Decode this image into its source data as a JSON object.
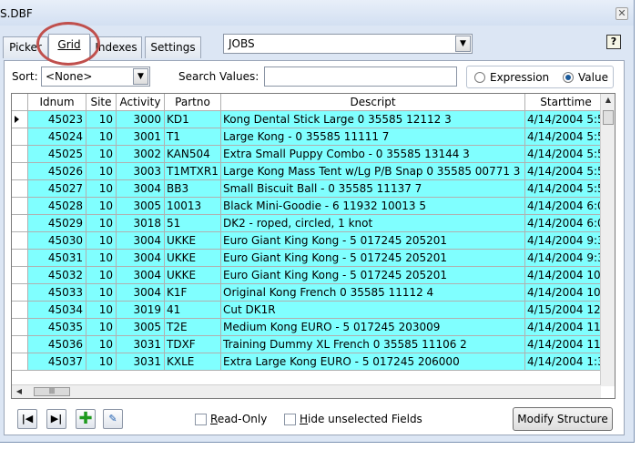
{
  "window": {
    "title": "S.DBF"
  },
  "tabs": [
    {
      "label": "Picker"
    },
    {
      "label": "Grid"
    },
    {
      "label": "Indexes"
    },
    {
      "label": "Settings"
    }
  ],
  "active_tab": "Grid",
  "table_select": {
    "value": "JOBS"
  },
  "help_icon": "help-icon",
  "sort": {
    "label": "Sort:",
    "value": "<None>"
  },
  "search": {
    "label": "Search Values:",
    "value": ""
  },
  "search_mode": {
    "options": [
      "Expression",
      "Value"
    ],
    "selected": "Value"
  },
  "grid": {
    "columns": [
      "Idnum",
      "Site",
      "Activity",
      "Partno",
      "Descript",
      "Starttime"
    ],
    "rows": [
      [
        "45023",
        "10",
        "3000",
        "KD1",
        "Kong Dental Stick Large 0 35585 12112 3",
        "4/14/2004 5:5"
      ],
      [
        "45024",
        "10",
        "3001",
        "T1",
        "Large Kong - 0 35585 11111 7",
        "4/14/2004 5:5"
      ],
      [
        "45025",
        "10",
        "3002",
        "KAN504",
        "Extra Small Puppy Combo - 0 35585 13144 3",
        "4/14/2004 5:5"
      ],
      [
        "45026",
        "10",
        "3003",
        "T1MTXR1",
        "Large Kong Mass Tent w/Lg P/B Snap 0 35585 00771 3",
        "4/14/2004 5:5"
      ],
      [
        "45027",
        "10",
        "3004",
        "BB3",
        "Small Biscuit Ball - 0 35585 11137 7",
        "4/14/2004 5:5"
      ],
      [
        "45028",
        "10",
        "3005",
        "10013",
        "Black Mini-Goodie - 6 11932 10013 5",
        "4/14/2004 6:0"
      ],
      [
        "45029",
        "10",
        "3018",
        "51",
        "DK2 - roped, circled, 1 knot",
        "4/14/2004 6:0"
      ],
      [
        "45030",
        "10",
        "3004",
        "UKKE",
        "Euro Giant King Kong - 5 017245 205201",
        "4/14/2004 9:3"
      ],
      [
        "45031",
        "10",
        "3004",
        "UKKE",
        "Euro Giant King Kong - 5 017245 205201",
        "4/14/2004 9:3"
      ],
      [
        "45032",
        "10",
        "3004",
        "UKKE",
        "Euro Giant King Kong - 5 017245 205201",
        "4/14/2004 10"
      ],
      [
        "45033",
        "10",
        "3004",
        "K1F",
        "Original Kong French 0 35585 11112 4",
        "4/14/2004 10"
      ],
      [
        "45034",
        "10",
        "3019",
        "41",
        "Cut DK1R",
        "4/15/2004 12"
      ],
      [
        "45035",
        "10",
        "3005",
        "T2E",
        "Medium Kong EURO - 5 017245 203009",
        "4/14/2004 11"
      ],
      [
        "45036",
        "10",
        "3031",
        "TDXF",
        "Training Dummy XL French 0 35585 11106 2",
        "4/14/2004 11"
      ],
      [
        "45037",
        "10",
        "3031",
        "KXLE",
        "Extra Large Kong EURO - 5 017245 206000",
        "4/14/2004 1:3"
      ]
    ],
    "row_color": "#80ffff"
  },
  "bottom": {
    "first_record_icon": "first-record-icon",
    "last_record_icon": "last-record-icon",
    "add_icon": "add-record-icon",
    "edit_icon": "edit-record-icon",
    "read_only": {
      "label_u": "R",
      "label_rest": "ead-Only",
      "checked": false
    },
    "hide_unselected": {
      "label_u": "H",
      "label_rest": "ide unselected Fields",
      "checked": false
    },
    "modify_button": "Modify Structure"
  },
  "annotation_color": "#c0504d"
}
